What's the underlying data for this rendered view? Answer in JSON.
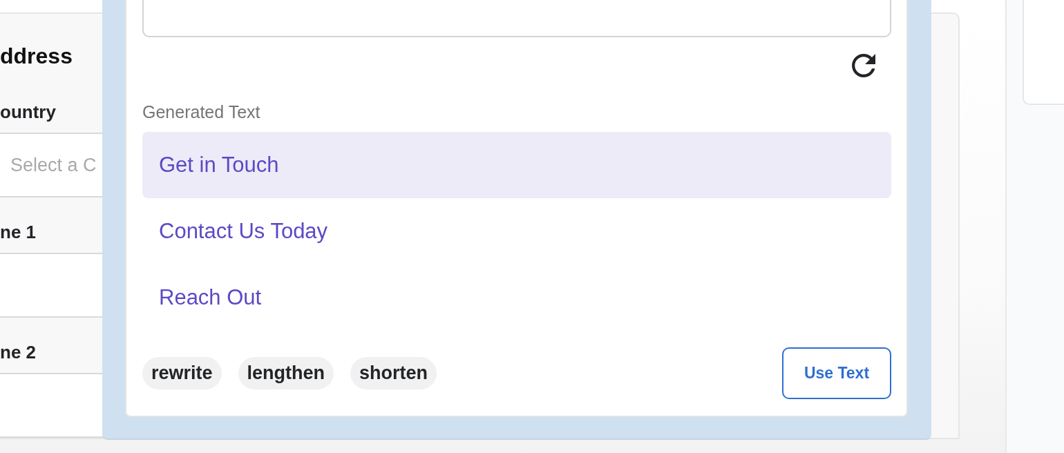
{
  "form": {
    "section_title": "ddress",
    "fields": [
      {
        "label": "ountry",
        "kind": "select",
        "placeholder": "Select a C"
      },
      {
        "label": "ne 1",
        "kind": "text"
      },
      {
        "label": "ne 2",
        "kind": "text"
      }
    ]
  },
  "text_generator": {
    "generated_label": "Generated Text",
    "suggestions": [
      {
        "text": "Get in Touch",
        "selected": true
      },
      {
        "text": "Contact Us Today",
        "selected": false
      },
      {
        "text": "Reach Out",
        "selected": false
      }
    ],
    "actions": [
      "rewrite",
      "lengthen",
      "shorten"
    ],
    "use_button": "Use Text"
  }
}
